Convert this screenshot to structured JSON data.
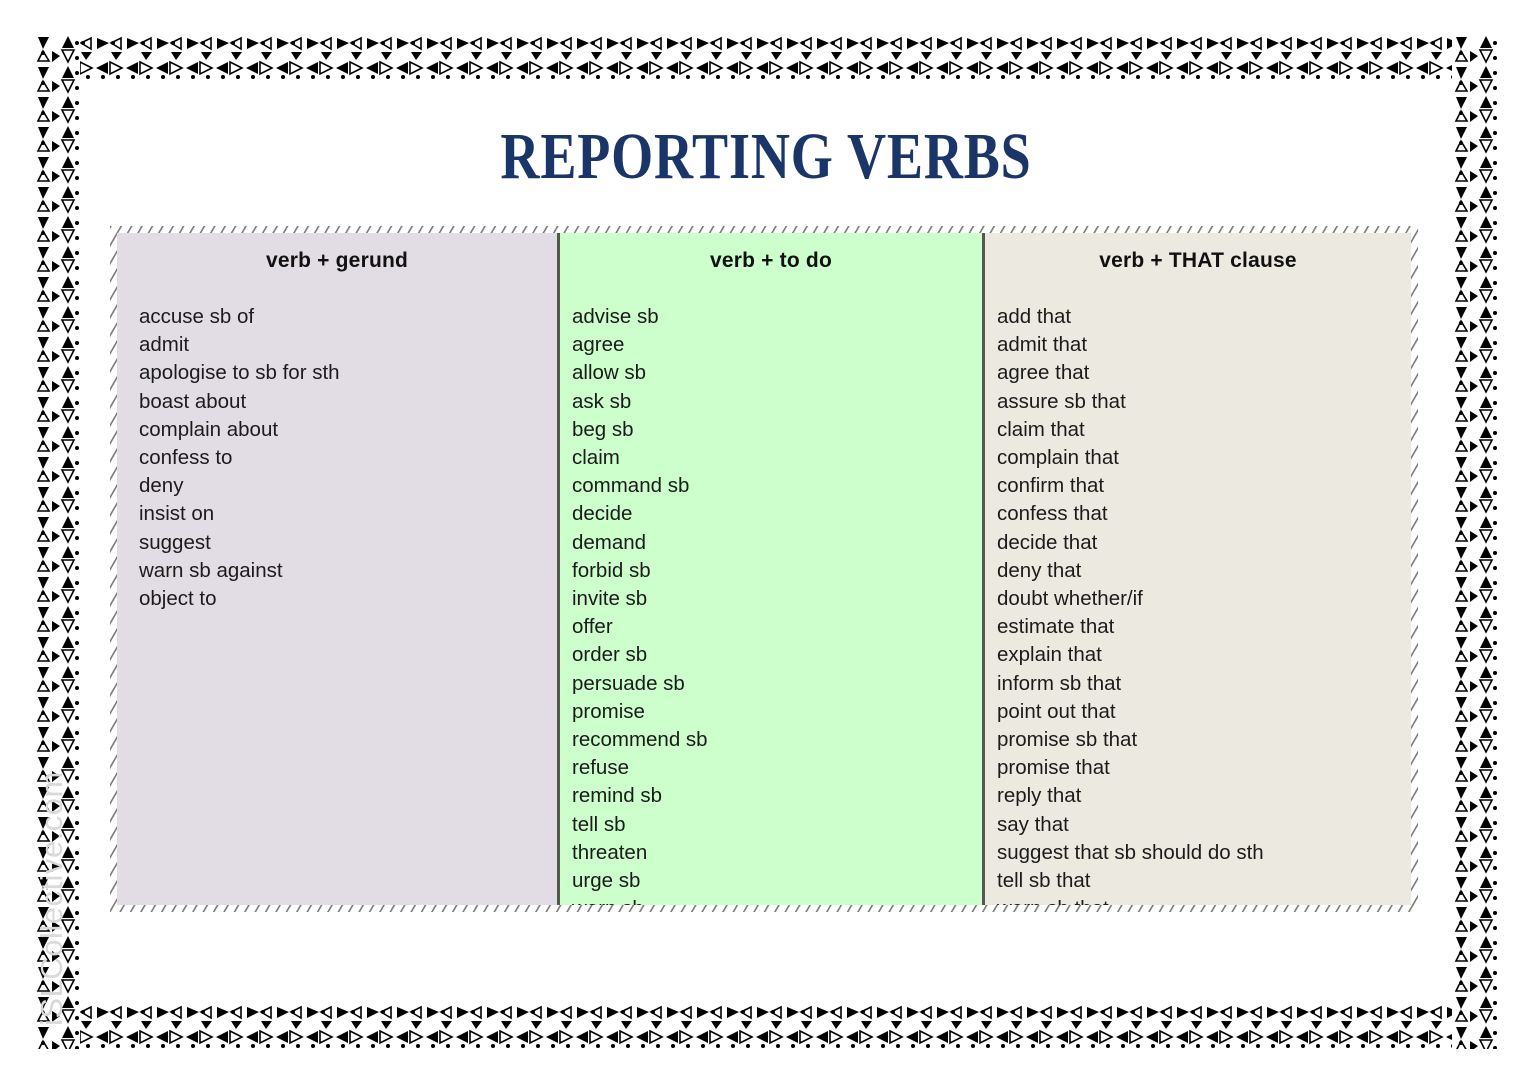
{
  "page": {
    "title": "REPORTING VERBS",
    "watermark": "iSLCollective.com",
    "colors": {
      "title": "#1a3668",
      "col_gerund_bg": "#e2dde5",
      "col_todo_bg": "#ccffcc",
      "col_that_bg": "#eceae0",
      "divider": "#4f5a4a",
      "text": "#1b1b1b",
      "watermark": "#d9d9d9",
      "border_pattern": "#000000"
    }
  },
  "table": {
    "columns": [
      {
        "id": "verb-gerund",
        "header": "verb + gerund",
        "items": [
          "accuse sb of",
          "admit",
          "apologise to sb for sth",
          "boast about",
          "complain about",
          "confess to",
          "deny",
          "insist on",
          "suggest",
          "warn sb against",
          "object to"
        ]
      },
      {
        "id": "verb-to-do",
        "header": "verb + to do",
        "items": [
          "advise sb",
          "agree",
          "allow sb",
          "ask sb",
          "beg sb",
          "claim",
          "command sb",
          "decide",
          "demand",
          "forbid sb",
          "invite sb",
          "offer",
          "order sb",
          "persuade sb",
          "promise",
          "recommend sb",
          "refuse",
          "remind sb",
          "tell sb",
          "threaten",
          "urge sb",
          "warn sb"
        ]
      },
      {
        "id": "verb-that-clause",
        "header": "verb + THAT clause",
        "items": [
          "add that",
          "admit that",
          "agree that",
          "assure sb that",
          "claim that",
          "complain that",
          "confirm that",
          "confess that",
          "decide that",
          "deny that",
          "doubt whether/if",
          "estimate that",
          "explain that",
          "inform sb that",
          "point out that",
          "promise sb that",
          "promise that",
          "reply that",
          "say that",
          "suggest that sb should do sth",
          "tell sb that",
          "warn sb that"
        ]
      }
    ]
  }
}
